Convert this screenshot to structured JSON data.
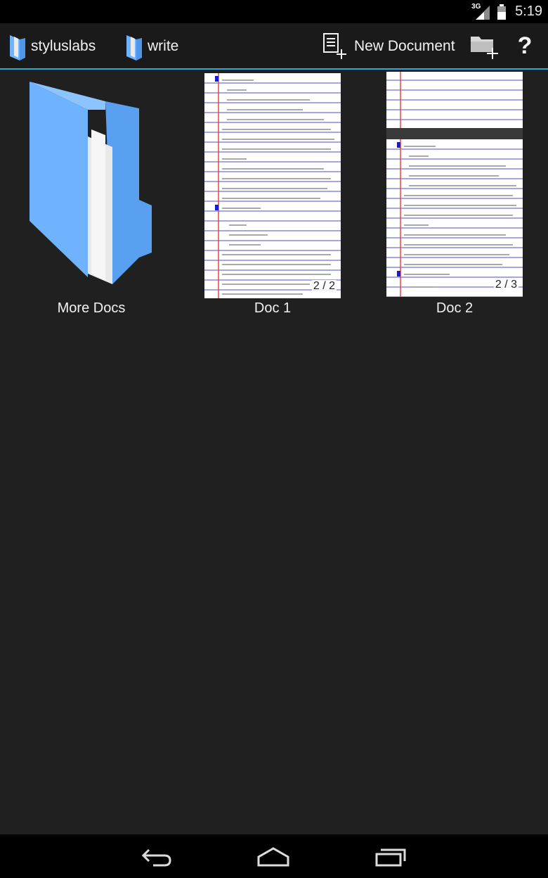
{
  "status_bar": {
    "network": "3G",
    "time": "5:19"
  },
  "action_bar": {
    "breadcrumbs": [
      {
        "label": "styluslabs"
      },
      {
        "label": "write"
      }
    ],
    "new_document_label": "New Document",
    "help_glyph": "?"
  },
  "items": [
    {
      "label": "More Docs",
      "icon": "folder-icon"
    },
    {
      "label": "Doc 1",
      "page_count": "2 / 2"
    },
    {
      "label": "Doc 2",
      "page_count": "2 / 3"
    }
  ],
  "colors": {
    "accent": "#33a5d8",
    "folder": "#6fb3ff",
    "background": "#202020"
  },
  "nav_bar": {
    "icons": [
      "back-icon",
      "home-icon",
      "recent-apps-icon"
    ]
  }
}
